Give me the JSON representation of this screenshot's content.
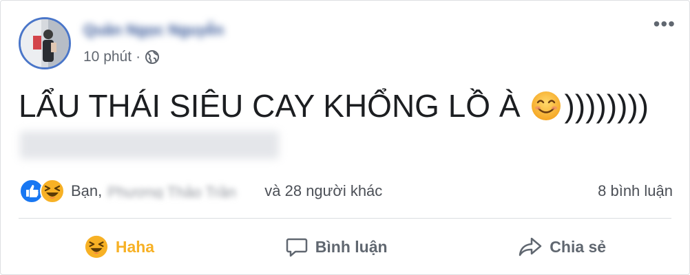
{
  "post": {
    "author_name": "Quân Ngọc Nguyễn",
    "timestamp": "10 phút",
    "separator": "·",
    "privacy_icon": "globe-icon",
    "more_icon": "more-options-icon",
    "text": "LẨU THÁI SIÊU CAY KHỔNG LỒ À",
    "text_emoji": "smiling-face-icon",
    "text_suffix": "))))))))"
  },
  "reactions": {
    "icons": [
      "like-reaction-icon",
      "haha-reaction-icon"
    ],
    "friend_label": "Bạn,",
    "blurred_name": "Phương Thảo Trần",
    "others_label": "và 28 người khác",
    "comments_label": "8 bình luận"
  },
  "actions": {
    "react_label": "Haha",
    "comment_label": "Bình luận",
    "share_label": "Chia sẻ"
  },
  "colors": {
    "accent_haha": "#f7b125",
    "like_blue": "#1877f2",
    "link": "#385898"
  }
}
